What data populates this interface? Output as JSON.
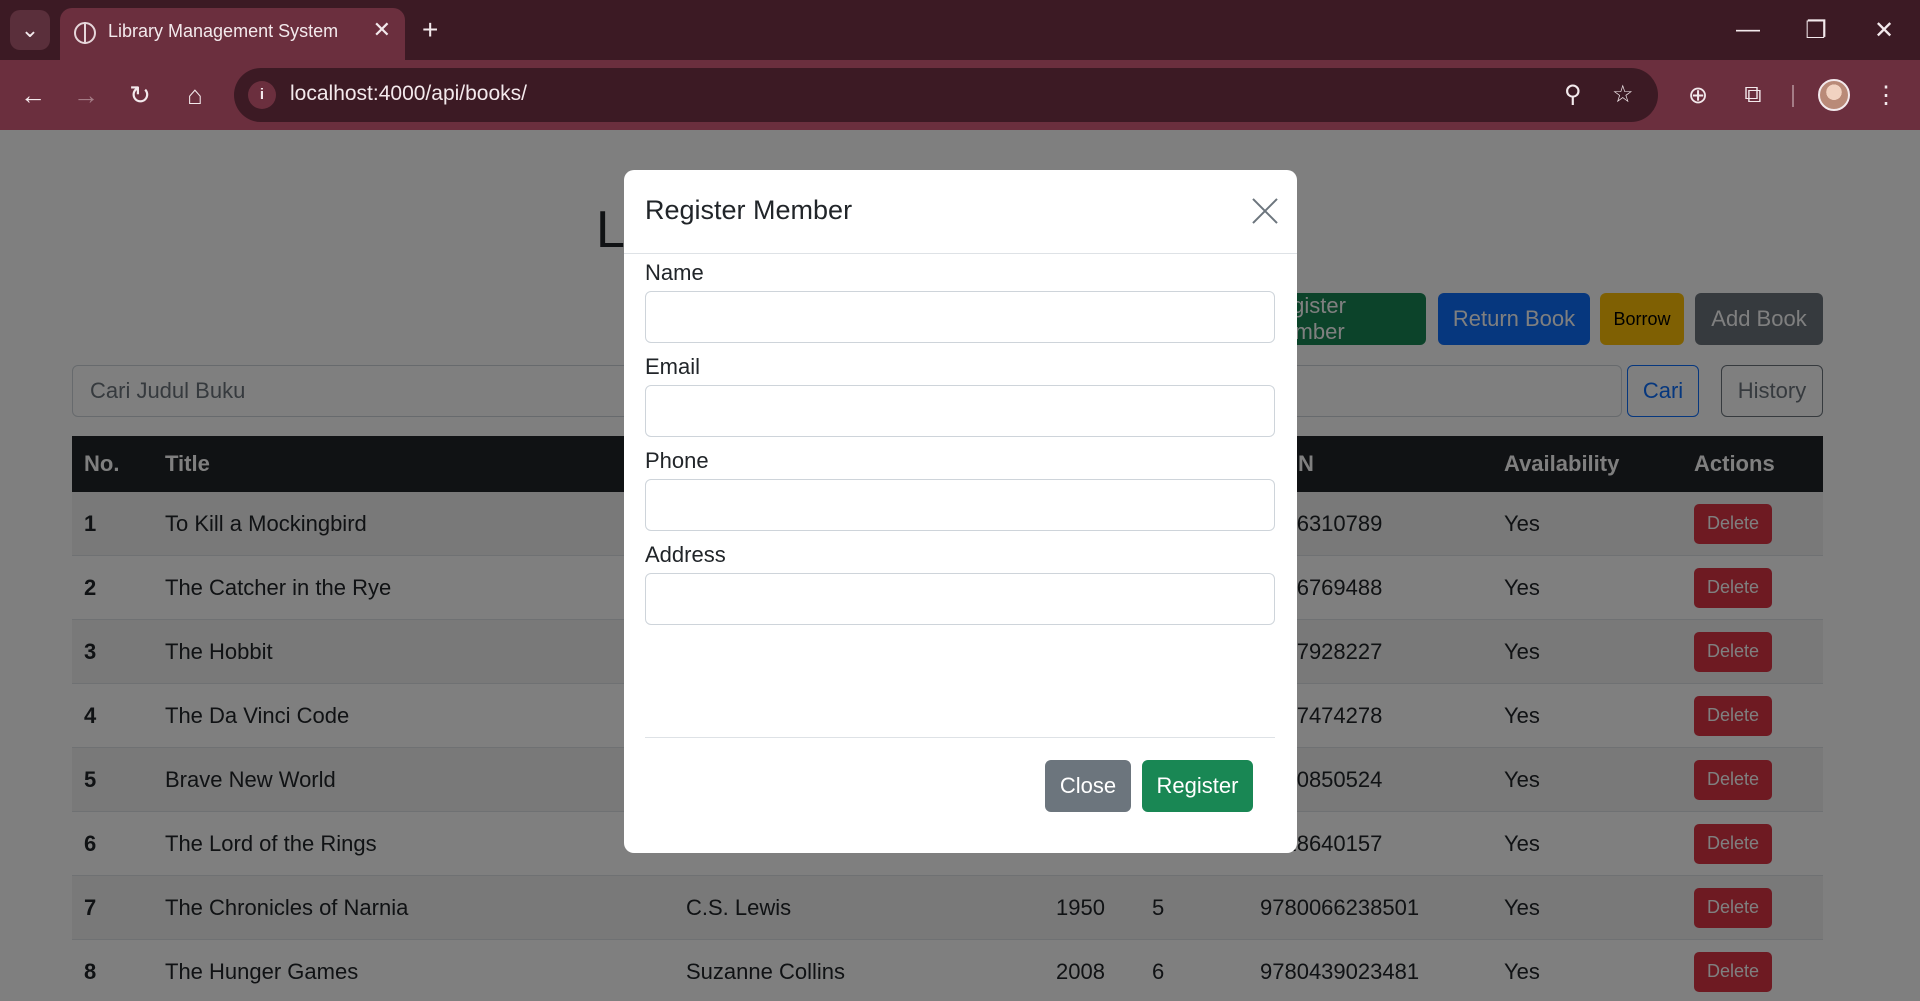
{
  "browser": {
    "tab_title": "Library Management System",
    "url": "localhost:4000/api/books/",
    "icons": {
      "tab_menu": "chevron-down-icon",
      "favicon": "globe-icon",
      "tab_close": "close-icon",
      "new_tab": "plus-icon",
      "back": "arrow-left-icon",
      "forward": "arrow-right-icon",
      "reload": "reload-icon",
      "home": "home-icon",
      "site_info": "info-icon",
      "zoom": "zoom-out-icon",
      "bookmark": "star-icon",
      "extension_add": "plus-circle-icon",
      "extensions": "puzzle-icon",
      "menu": "kebab-menu-icon"
    },
    "glyphs": {
      "tab_menu": "⌄",
      "tab_close": "✕",
      "new_tab": "+",
      "minimize": "—",
      "restore": "❐",
      "close": "✕",
      "back": "←",
      "forward": "→",
      "reload": "↻",
      "home": "⌂",
      "info": "i",
      "zoom": "⚲",
      "star": "☆",
      "add": "⊕",
      "puzzle": "⧉",
      "menu": "⋮"
    }
  },
  "page": {
    "title": "L",
    "actions": {
      "register_member": "Register Member",
      "return_book": "Return Book",
      "borrow": "Borrow",
      "add_book": "Add Book"
    },
    "search": {
      "placeholder": "Cari Judul Buku",
      "search_button": "Cari",
      "history_button": "History"
    },
    "table": {
      "headers": {
        "no": "No.",
        "title": "Title",
        "author": "",
        "year": "",
        "copies": "",
        "isbn": "N",
        "availability": "Availability",
        "actions": "Actions"
      },
      "rows": [
        {
          "no": "1",
          "title": "To Kill a Mockingbird",
          "author": "",
          "year": "",
          "copies": "",
          "isbn": "0446310789",
          "availability": "Yes",
          "action": "Delete"
        },
        {
          "no": "2",
          "title": "The Catcher in the Rye",
          "author": "",
          "year": "",
          "copies": "",
          "isbn": "0316769488",
          "availability": "Yes",
          "action": "Delete"
        },
        {
          "no": "3",
          "title": "The Hobbit",
          "author": "",
          "year": "",
          "copies": "",
          "isbn": "0547928227",
          "availability": "Yes",
          "action": "Delete"
        },
        {
          "no": "4",
          "title": "The Da Vinci Code",
          "author": "",
          "year": "",
          "copies": "",
          "isbn": "0307474278",
          "availability": "Yes",
          "action": "Delete"
        },
        {
          "no": "5",
          "title": "Brave New World",
          "author": "",
          "year": "",
          "copies": "",
          "isbn": "0060850524",
          "availability": "Yes",
          "action": "Delete"
        },
        {
          "no": "6",
          "title": "The Lord of the Rings",
          "author": "",
          "year": "",
          "copies": "",
          "isbn": "0618640157",
          "availability": "Yes",
          "action": "Delete"
        },
        {
          "no": "7",
          "title": "The Chronicles of Narnia",
          "author": "C.S. Lewis",
          "year": "1950",
          "copies": "5",
          "isbn": "9780066238501",
          "availability": "Yes",
          "action": "Delete"
        },
        {
          "no": "8",
          "title": "The Hunger Games",
          "author": "Suzanne Collins",
          "year": "2008",
          "copies": "6",
          "isbn": "9780439023481",
          "availability": "Yes",
          "action": "Delete"
        }
      ]
    }
  },
  "modal": {
    "title": "Register Member",
    "fields": {
      "name": {
        "label": "Name",
        "value": ""
      },
      "email": {
        "label": "Email",
        "value": ""
      },
      "phone": {
        "label": "Phone",
        "value": ""
      },
      "address": {
        "label": "Address",
        "value": ""
      }
    },
    "close_button": "Close",
    "register_button": "Register"
  },
  "colors": {
    "success": "#198754",
    "primary": "#0d6efd",
    "warning": "#ffc107",
    "secondary": "#6c757d",
    "danger": "#dc3545",
    "dark": "#212529",
    "chrome_tabbar": "#3c1a24",
    "chrome_toolbar": "#6b2f3e"
  }
}
